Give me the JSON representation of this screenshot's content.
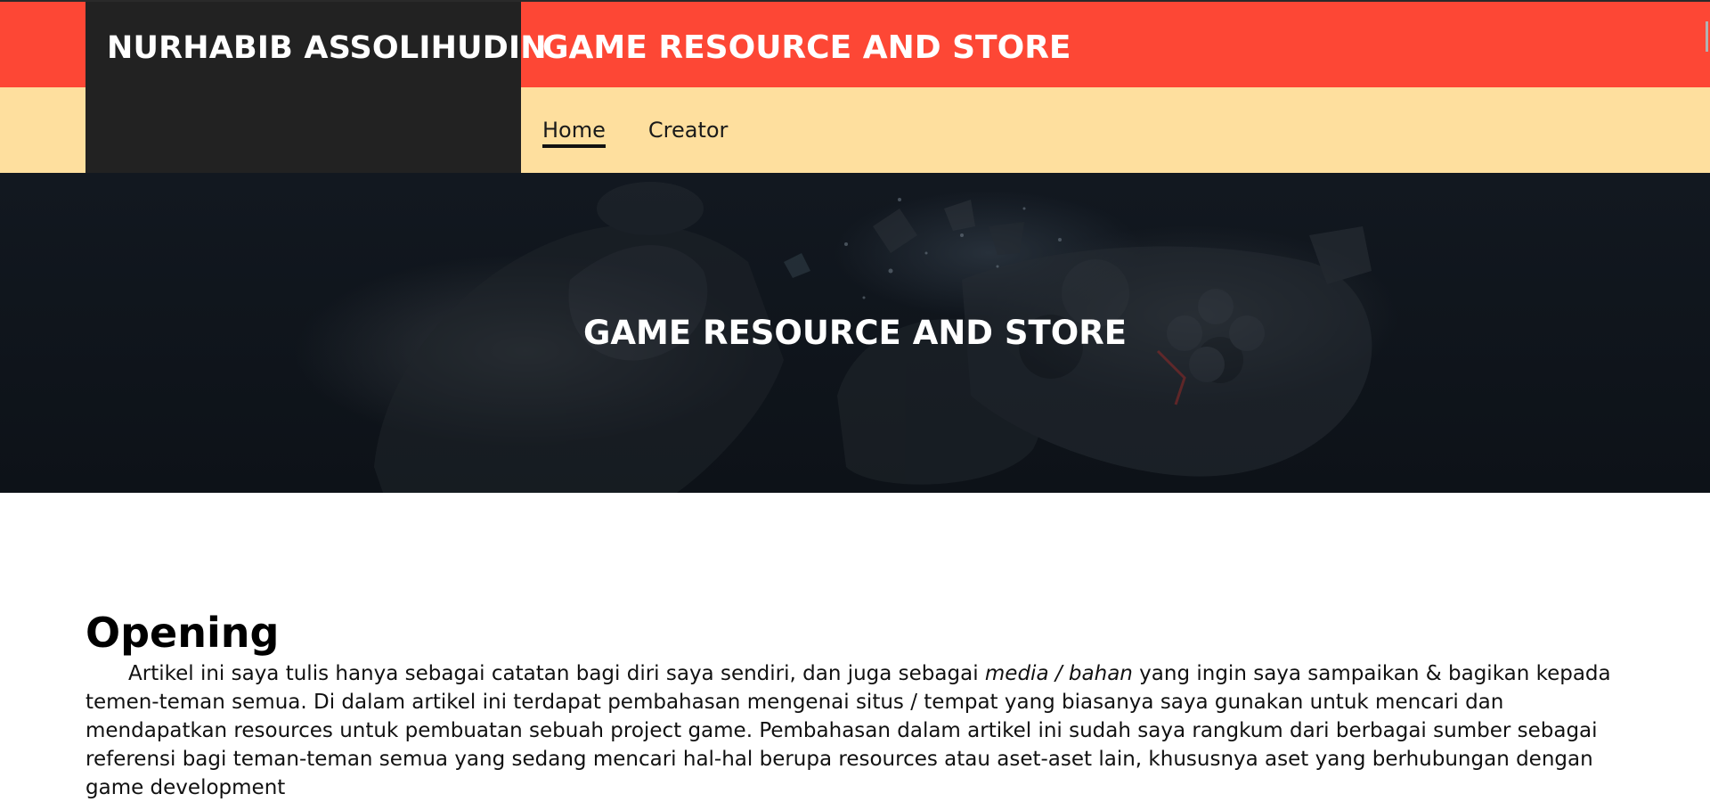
{
  "header": {
    "brand": "NURHABIB ASSOLIHUDIN",
    "title": "GAME RESOURCE AND STORE",
    "nav": [
      {
        "label": "Home",
        "active": true
      },
      {
        "label": "Creator",
        "active": false
      }
    ]
  },
  "hero": {
    "title": "GAME RESOURCE AND STORE"
  },
  "article": {
    "heading": "Opening",
    "paragraph_before": "Artikel ini saya tulis hanya sebagai catatan bagi diri saya sendiri, dan juga sebagai ",
    "paragraph_emphasis": "media / bahan",
    "paragraph_after": " yang ingin saya sampaikan & bagikan kepada temen-teman semua. Di dalam artikel ini terdapat pembahasan mengenai situs / tempat yang biasanya saya gunakan untuk mencari dan mendapatkan resources untuk pembuatan sebuah project game. Pembahasan dalam artikel ini sudah saya rangkum dari berbagai sumber sebagai referensi bagi teman-teman semua yang sedang mencari hal-hal berupa resources atau aset-aset lain, khususnya aset yang berhubungan dengan game development"
  },
  "colors": {
    "red": "#fd4735",
    "cream": "#fedf9e",
    "dark": "#222222"
  }
}
